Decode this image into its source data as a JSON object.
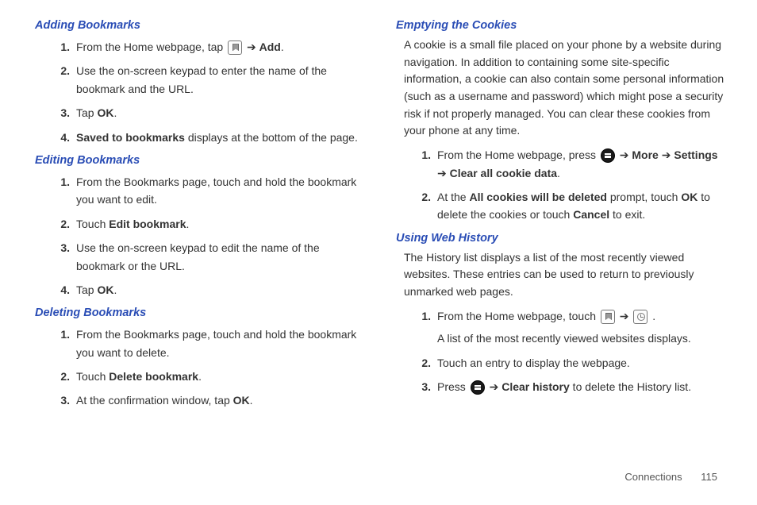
{
  "footer": {
    "section": "Connections",
    "page": "115"
  },
  "arrow": "➔",
  "left": {
    "adding": {
      "heading": "Adding Bookmarks",
      "s1a": "From the Home webpage, tap ",
      "s1b": "Add",
      "s2": "Use the on-screen keypad to enter the name of the bookmark and the URL.",
      "s3a": "Tap ",
      "s3b": "OK",
      "s4a": "Saved to bookmarks",
      "s4b": " displays at the bottom of the page."
    },
    "editing": {
      "heading": "Editing Bookmarks",
      "s1": "From the Bookmarks page, touch and hold the bookmark you want to edit.",
      "s2a": "Touch ",
      "s2b": "Edit bookmark",
      "s3": "Use the on-screen keypad to edit the name of the bookmark or the URL.",
      "s4a": "Tap ",
      "s4b": "OK"
    },
    "deleting": {
      "heading": "Deleting Bookmarks",
      "s1": "From the Bookmarks page, touch and hold the bookmark you want to delete.",
      "s2a": "Touch ",
      "s2b": "Delete bookmark",
      "s3a": "At the confirmation window, tap ",
      "s3b": "OK"
    }
  },
  "right": {
    "cookies": {
      "heading": "Emptying the Cookies",
      "para": "A cookie is a small file placed on your phone by a website during navigation. In addition to containing some site-specific information, a cookie can also contain some personal information (such as a username and password) which might pose a security risk if not properly managed. You can clear these cookies from your phone at any time.",
      "s1a": "From the Home webpage, press ",
      "s1b": "More",
      "s1c": "Settings",
      "s1d": "Clear all cookie data",
      "s2a": "At the ",
      "s2b": "All cookies will be deleted",
      "s2c": " prompt, touch ",
      "s2d": "OK",
      "s2e": " to delete the cookies or touch ",
      "s2f": "Cancel",
      "s2g": " to exit."
    },
    "history": {
      "heading": "Using Web History",
      "para": "The History list displays a list of the most recently viewed websites. These entries can be used to return to previously unmarked web pages.",
      "s1a": "From the Home webpage, touch ",
      "s1b": "A list of the most recently viewed websites displays.",
      "s2": "Touch an entry to display the webpage.",
      "s3a": "Press ",
      "s3b": "Clear history",
      "s3c": " to delete the History list."
    }
  }
}
